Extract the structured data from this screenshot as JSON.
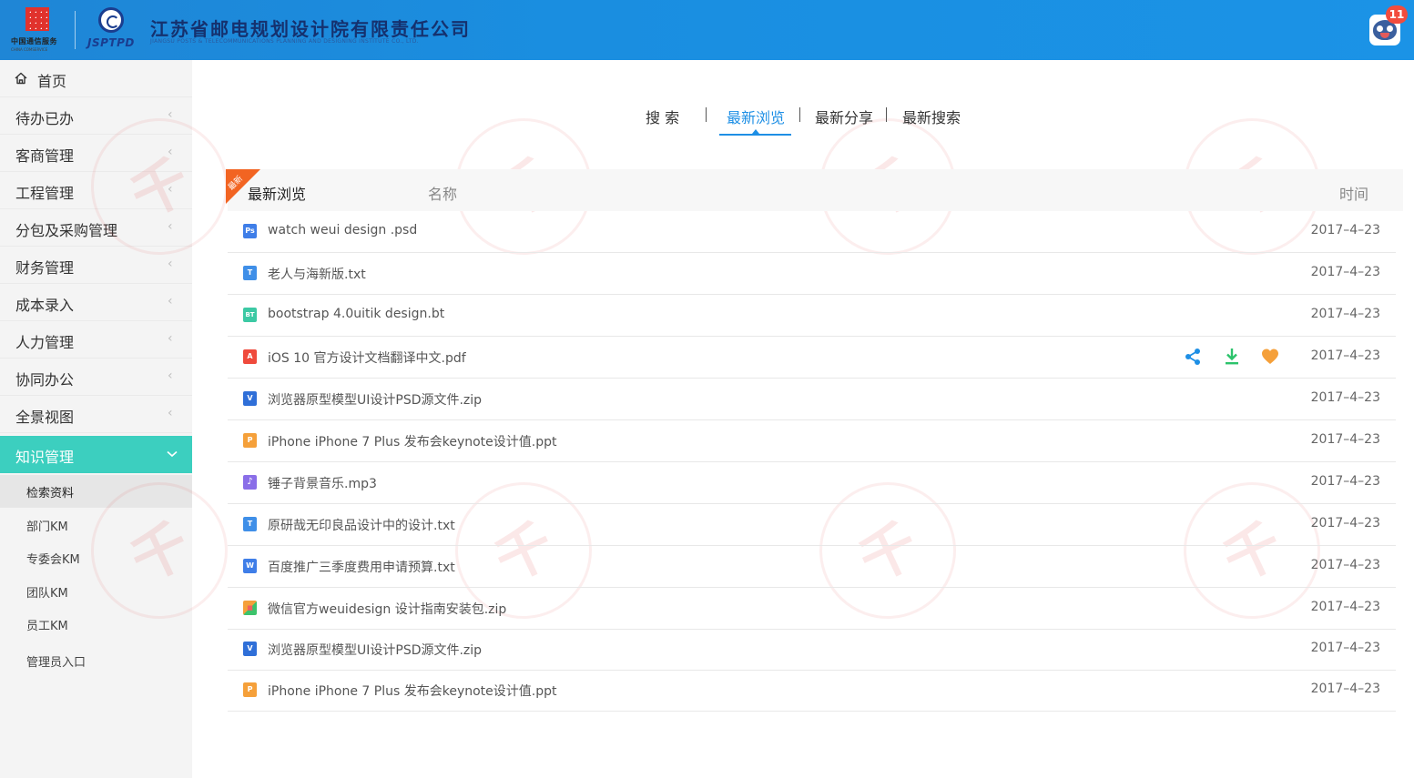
{
  "header": {
    "company": "江苏省邮电规划设计院有限责任公司",
    "company_sub": "JIANGSU POSTS & TELECOMMUNICATIONS PLANNING AND DESIGNING INSTITUTE CO., LTD.",
    "logo1_text": "中国通信服务",
    "logo1_sub": "CHINA COMSERVICE",
    "logo2_text": "JSPTPD",
    "notification_count": "11"
  },
  "sidebar": {
    "items": [
      {
        "label": "首页"
      },
      {
        "label": "待办已办"
      },
      {
        "label": "客商管理"
      },
      {
        "label": "工程管理"
      },
      {
        "label": "分包及采购管理"
      },
      {
        "label": "财务管理"
      },
      {
        "label": "成本录入"
      },
      {
        "label": "人力管理"
      },
      {
        "label": "协同办公"
      },
      {
        "label": "全景视图"
      },
      {
        "label": "知识管理"
      }
    ],
    "sub_items": [
      {
        "label": "检索资料"
      },
      {
        "label": "部门KM"
      },
      {
        "label": "专委会KM"
      },
      {
        "label": "团队KM"
      },
      {
        "label": "员工KM"
      },
      {
        "label": "管理员入口"
      }
    ]
  },
  "tabs": [
    {
      "label": "搜  索"
    },
    {
      "label": "最新浏览"
    },
    {
      "label": "最新分享"
    },
    {
      "label": "最新搜索"
    }
  ],
  "table": {
    "corner_tag": "最新",
    "title": "最新浏览",
    "col_name": "名称",
    "col_time": "时间",
    "rows": [
      {
        "name": "watch weui design .psd",
        "date": "2017–4–23",
        "icon": "Ps"
      },
      {
        "name": "老人与海新版.txt",
        "date": "2017–4–23",
        "icon": "T"
      },
      {
        "name": "bootstrap 4.0uitik design.bt",
        "date": "2017–4–23",
        "icon": "BT"
      },
      {
        "name": "iOS 10 官方设计文档翻译中文.pdf",
        "date": "2017–4–23",
        "icon": "A"
      },
      {
        "name": "浏览器原型模型UI设计PSD源文件.zip",
        "date": "2017–4–23",
        "icon": "V"
      },
      {
        "name": "iPhone iPhone 7 Plus 发布会keynote设计值.ppt",
        "date": "2017–4–23",
        "icon": "P"
      },
      {
        "name": "锤子背景音乐.mp3",
        "date": "2017–4–23",
        "icon": "♪"
      },
      {
        "name": "原研哉无印良品设计中的设计.txt",
        "date": "2017–4–23",
        "icon": "T"
      },
      {
        "name": "百度推广三季度费用申请预算.txt",
        "date": "2017–4–23",
        "icon": "W"
      },
      {
        "name": "微信官方weuidesign 设计指南安装包.zip",
        "date": "2017–4–23",
        "icon": "■"
      },
      {
        "name": "浏览器原型模型UI设计PSD源文件.zip",
        "date": "2017–4–23",
        "icon": "V"
      },
      {
        "name": "iPhone iPhone 7 Plus 发布会keynote设计值.ppt",
        "date": "2017–4–23",
        "icon": "P"
      }
    ]
  },
  "colors": {
    "header_blue": "#1b8fe2",
    "accent_teal": "#3ccfbf",
    "tab_active": "#1e8fe5",
    "corner_orange": "#f26422",
    "share_blue": "#1e8fe5",
    "download_green": "#2cc36b",
    "favorite_orange": "#f5a03a"
  }
}
